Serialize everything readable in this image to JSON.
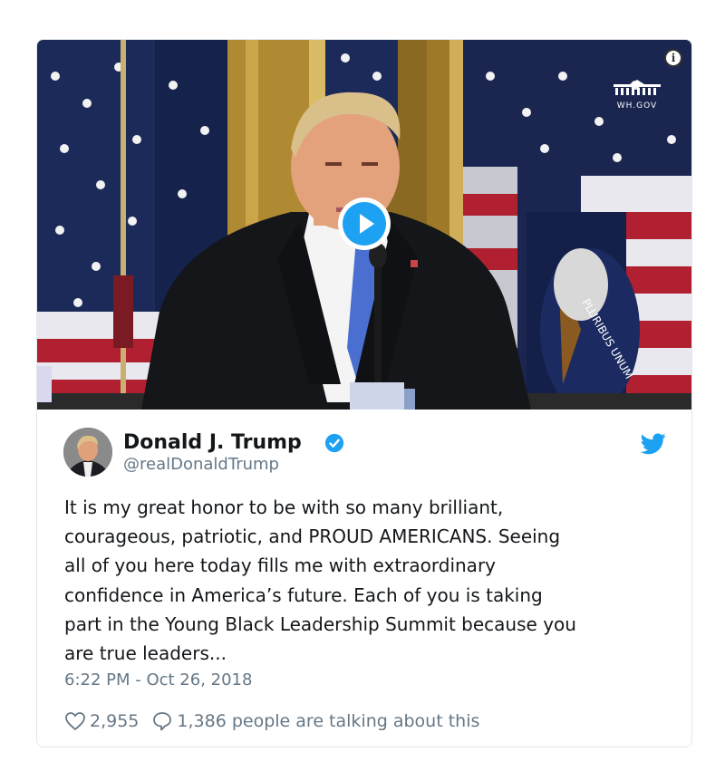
{
  "media": {
    "watermark": "WH.GOV",
    "info_glyph": "i",
    "seal_text": "PLURIBUS UNUM",
    "play_icon": "play-icon"
  },
  "tweet": {
    "author_name": "Donald J. Trump",
    "handle": "@realDonaldTrump",
    "verified": true,
    "text_lines": [
      "It is my great honor to be with so many brilliant,",
      "courageous, patriotic, and PROUD AMERICANS. Seeing",
      "all of you here today fills me with extraordinary",
      "confidence in America’s future. Each of you is taking",
      "part in the Young Black Leadership Summit because you",
      "are true leaders..."
    ],
    "timestamp": "6:22 PM - Oct 26, 2018",
    "likes": "2,955",
    "talking": "1,386 people are talking about this"
  },
  "colors": {
    "brand_blue": "#1da1f2",
    "text": "#14171a",
    "muted": "#657786",
    "border": "#e1e8ed"
  }
}
